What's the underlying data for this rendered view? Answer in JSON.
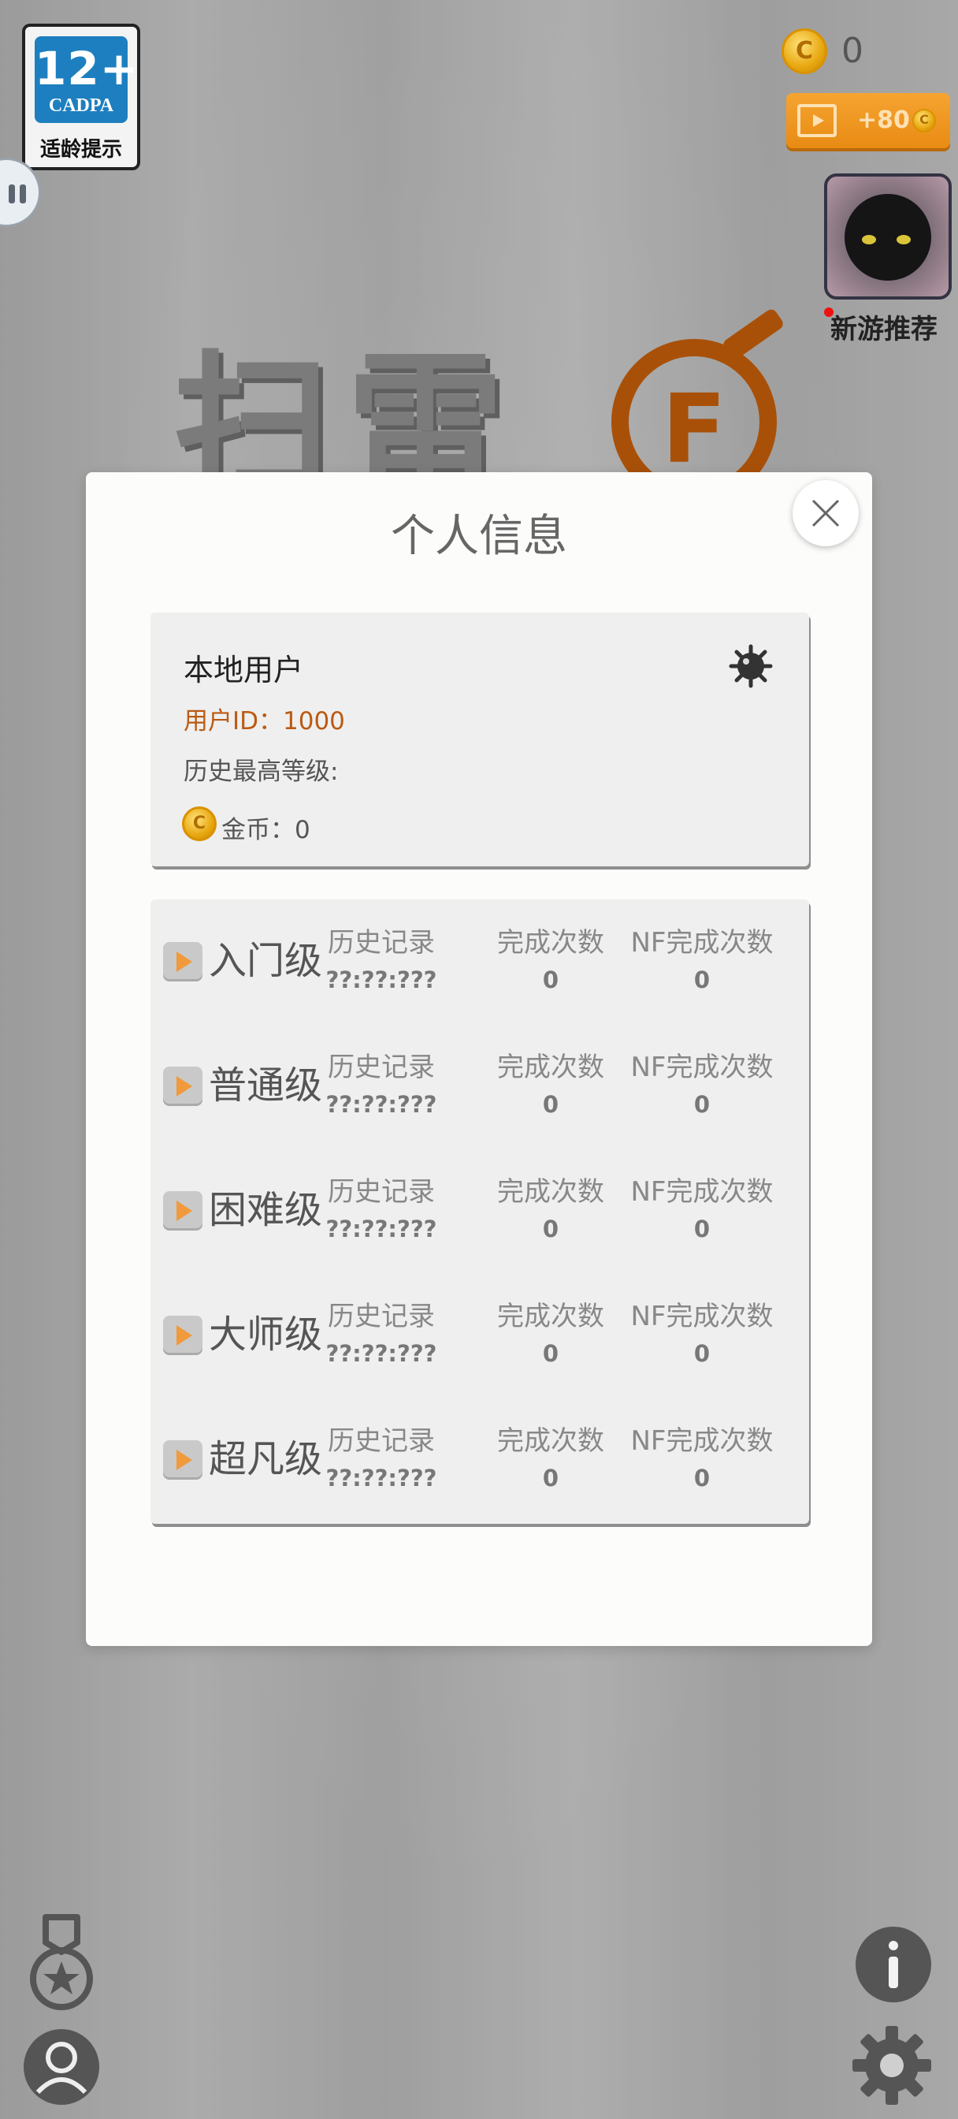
{
  "age_rating": {
    "number": "12+",
    "org": "CADPA",
    "caption": "适龄提示"
  },
  "topbar": {
    "coin_glyph": "C",
    "coins": "0",
    "video_reward": "+80",
    "game_recommend_label": "新游推荐"
  },
  "title_art": {
    "text": "扫雷",
    "bomb_letter": "F"
  },
  "modal": {
    "title": "个人信息",
    "user": {
      "name": "本地用户",
      "id_line": "用户ID：1000",
      "highest_level_label": "历史最高等级:",
      "coins_line": "金币：0"
    },
    "columns": {
      "history": "历史记录",
      "completions": "完成次数",
      "nf_completions": "NF完成次数"
    },
    "levels": [
      {
        "name": "入门级",
        "history": "??:??:???",
        "completions": "0",
        "nf_completions": "0"
      },
      {
        "name": "普通级",
        "history": "??:??:???",
        "completions": "0",
        "nf_completions": "0"
      },
      {
        "name": "困难级",
        "history": "??:??:???",
        "completions": "0",
        "nf_completions": "0"
      },
      {
        "name": "大师级",
        "history": "??:??:???",
        "completions": "0",
        "nf_completions": "0"
      },
      {
        "name": "超凡级",
        "history": "??:??:???",
        "completions": "0",
        "nf_completions": "0"
      }
    ]
  },
  "icons": {
    "close": "close-icon",
    "mine": "mine-icon",
    "medal": "medal-icon",
    "profile": "profile-icon",
    "info": "info-icon",
    "settings": "gear-icon"
  },
  "colors": {
    "accent_orange": "#e88b14",
    "user_id": "#bb5a12",
    "age_blue": "#1d7fbf"
  }
}
